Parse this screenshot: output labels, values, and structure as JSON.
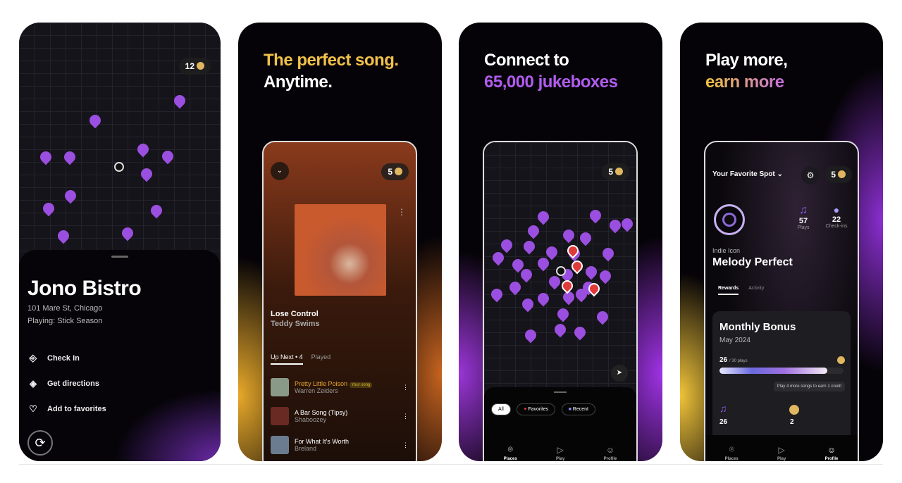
{
  "screens": [
    {
      "coins": "12",
      "venue": "Jono Bistro",
      "address": "101 Mare St, Chicago",
      "playing": "Playing: Stick Season",
      "actions": [
        {
          "icon": "check-in-icon",
          "label": "Check In"
        },
        {
          "icon": "directions-icon",
          "label": "Get directions"
        },
        {
          "icon": "heart-icon",
          "label": "Add to favorites"
        }
      ]
    },
    {
      "headline_1": "The perfect song.",
      "headline_2": "Anytime.",
      "coins": "5",
      "song": "Lose Control",
      "artist": "Teddy Swims",
      "tabs": [
        "Up Next • 4",
        "Played"
      ],
      "your_song_badge": "Your song",
      "queue": [
        {
          "title": "Pretty Little Poison",
          "artist": "Warren Zeiders"
        },
        {
          "title": "A Bar Song (Tipsy)",
          "artist": "Shaboozey"
        },
        {
          "title": "For What It's Worth",
          "artist": "Breland"
        }
      ]
    },
    {
      "headline_1": "Connect to",
      "headline_2": "65,000 jukeboxes",
      "coins": "5",
      "filters": [
        "All",
        "Favorites",
        "Recent"
      ],
      "nav": [
        {
          "icon": "location-pin-icon",
          "label": "Places"
        },
        {
          "icon": "play-icon",
          "label": "Play"
        },
        {
          "icon": "person-icon",
          "label": "Profile"
        }
      ]
    },
    {
      "headline_1": "Play more,",
      "headline_2": "earn more",
      "coins": "5",
      "spot": "Your Favorite Spot",
      "plays": "57",
      "plays_label": "Plays",
      "checkins": "22",
      "checkins_label": "Check-ins",
      "rank": "Indie Icon",
      "user": "Melody Perfect",
      "tabs": [
        "Rewards",
        "Activity"
      ],
      "bonus_title": "Monthly Bonus",
      "bonus_month": "May 2024",
      "progress_value": "26",
      "progress_total": "/ 30 plays",
      "progress_fraction": 0.8667,
      "tooltip": "Play 4 more songs to earn 1 credit",
      "stat_plays": "26",
      "stat_credits": "2",
      "nav": [
        {
          "icon": "location-pin-icon",
          "label": "Places"
        },
        {
          "icon": "play-icon",
          "label": "Play"
        },
        {
          "icon": "person-icon",
          "label": "Profile"
        }
      ]
    }
  ],
  "colors": {
    "purple": "#9b4fe0",
    "gold": "#f0c43a",
    "orange": "#c7641f"
  }
}
